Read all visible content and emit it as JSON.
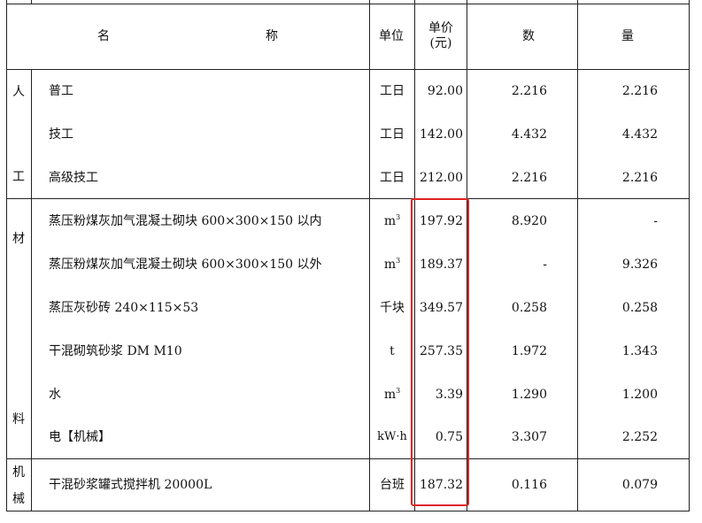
{
  "header": {
    "name_left": "名",
    "name_right": "称",
    "unit": "单位",
    "price_line1": "单价",
    "price_line2": "(元)",
    "qty1": "数",
    "qty2": "量"
  },
  "groups": {
    "labor": [
      "人",
      "工"
    ],
    "material": [
      "材",
      "料"
    ],
    "machine": [
      "机",
      "械"
    ]
  },
  "rows": [
    {
      "name": "普工",
      "unit": "工日",
      "price": "92.00",
      "qty1": "2.216",
      "qty2": "2.216"
    },
    {
      "name": "技工",
      "unit": "工日",
      "price": "142.00",
      "qty1": "4.432",
      "qty2": "4.432"
    },
    {
      "name": "高级技工",
      "unit": "工日",
      "price": "212.00",
      "qty1": "2.216",
      "qty2": "2.216"
    },
    {
      "name": "蒸压粉煤灰加气混凝土砌块 600×300×150 以内",
      "unit": "m",
      "unit_sup": "3",
      "price": "197.92",
      "qty1": "8.920",
      "qty2": "-"
    },
    {
      "name": "蒸压粉煤灰加气混凝土砌块 600×300×150 以外",
      "unit": "m",
      "unit_sup": "3",
      "price": "189.37",
      "qty1": "-",
      "qty2": "9.326"
    },
    {
      "name": "蒸压灰砂砖 240×115×53",
      "unit": "千块",
      "price": "349.57",
      "qty1": "0.258",
      "qty2": "0.258"
    },
    {
      "name": "干混砌筑砂浆 DM M10",
      "unit": "t",
      "price": "257.35",
      "qty1": "1.972",
      "qty2": "1.343"
    },
    {
      "name": "水",
      "unit": "m",
      "unit_sup": "3",
      "price": "3.39",
      "qty1": "1.290",
      "qty2": "1.200"
    },
    {
      "name": "电【机械】",
      "unit": "kW·h",
      "price": "0.75",
      "qty1": "3.307",
      "qty2": "2.252"
    },
    {
      "name": "干混砂浆罐式搅拌机 20000L",
      "unit": "台班",
      "price": "187.32",
      "qty1": "0.116",
      "qty2": "0.079"
    }
  ],
  "highlight_color": "#e02424"
}
